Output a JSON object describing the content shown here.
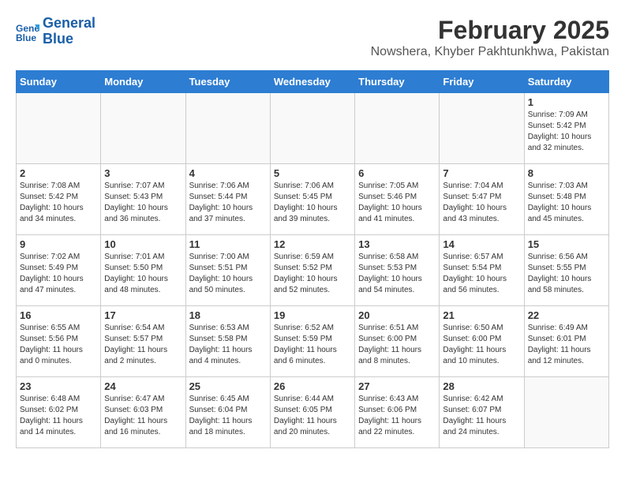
{
  "header": {
    "logo_line1": "General",
    "logo_line2": "Blue",
    "title": "February 2025",
    "subtitle": "Nowshera, Khyber Pakhtunkhwa, Pakistan"
  },
  "weekdays": [
    "Sunday",
    "Monday",
    "Tuesday",
    "Wednesday",
    "Thursday",
    "Friday",
    "Saturday"
  ],
  "weeks": [
    [
      {
        "day": "",
        "sunrise": "",
        "sunset": "",
        "daylight": ""
      },
      {
        "day": "",
        "sunrise": "",
        "sunset": "",
        "daylight": ""
      },
      {
        "day": "",
        "sunrise": "",
        "sunset": "",
        "daylight": ""
      },
      {
        "day": "",
        "sunrise": "",
        "sunset": "",
        "daylight": ""
      },
      {
        "day": "",
        "sunrise": "",
        "sunset": "",
        "daylight": ""
      },
      {
        "day": "",
        "sunrise": "",
        "sunset": "",
        "daylight": ""
      },
      {
        "day": "1",
        "sunrise": "Sunrise: 7:09 AM",
        "sunset": "Sunset: 5:42 PM",
        "daylight": "Daylight: 10 hours and 32 minutes."
      }
    ],
    [
      {
        "day": "2",
        "sunrise": "Sunrise: 7:08 AM",
        "sunset": "Sunset: 5:42 PM",
        "daylight": "Daylight: 10 hours and 34 minutes."
      },
      {
        "day": "3",
        "sunrise": "Sunrise: 7:07 AM",
        "sunset": "Sunset: 5:43 PM",
        "daylight": "Daylight: 10 hours and 36 minutes."
      },
      {
        "day": "4",
        "sunrise": "Sunrise: 7:06 AM",
        "sunset": "Sunset: 5:44 PM",
        "daylight": "Daylight: 10 hours and 37 minutes."
      },
      {
        "day": "5",
        "sunrise": "Sunrise: 7:06 AM",
        "sunset": "Sunset: 5:45 PM",
        "daylight": "Daylight: 10 hours and 39 minutes."
      },
      {
        "day": "6",
        "sunrise": "Sunrise: 7:05 AM",
        "sunset": "Sunset: 5:46 PM",
        "daylight": "Daylight: 10 hours and 41 minutes."
      },
      {
        "day": "7",
        "sunrise": "Sunrise: 7:04 AM",
        "sunset": "Sunset: 5:47 PM",
        "daylight": "Daylight: 10 hours and 43 minutes."
      },
      {
        "day": "8",
        "sunrise": "Sunrise: 7:03 AM",
        "sunset": "Sunset: 5:48 PM",
        "daylight": "Daylight: 10 hours and 45 minutes."
      }
    ],
    [
      {
        "day": "9",
        "sunrise": "Sunrise: 7:02 AM",
        "sunset": "Sunset: 5:49 PM",
        "daylight": "Daylight: 10 hours and 47 minutes."
      },
      {
        "day": "10",
        "sunrise": "Sunrise: 7:01 AM",
        "sunset": "Sunset: 5:50 PM",
        "daylight": "Daylight: 10 hours and 48 minutes."
      },
      {
        "day": "11",
        "sunrise": "Sunrise: 7:00 AM",
        "sunset": "Sunset: 5:51 PM",
        "daylight": "Daylight: 10 hours and 50 minutes."
      },
      {
        "day": "12",
        "sunrise": "Sunrise: 6:59 AM",
        "sunset": "Sunset: 5:52 PM",
        "daylight": "Daylight: 10 hours and 52 minutes."
      },
      {
        "day": "13",
        "sunrise": "Sunrise: 6:58 AM",
        "sunset": "Sunset: 5:53 PM",
        "daylight": "Daylight: 10 hours and 54 minutes."
      },
      {
        "day": "14",
        "sunrise": "Sunrise: 6:57 AM",
        "sunset": "Sunset: 5:54 PM",
        "daylight": "Daylight: 10 hours and 56 minutes."
      },
      {
        "day": "15",
        "sunrise": "Sunrise: 6:56 AM",
        "sunset": "Sunset: 5:55 PM",
        "daylight": "Daylight: 10 hours and 58 minutes."
      }
    ],
    [
      {
        "day": "16",
        "sunrise": "Sunrise: 6:55 AM",
        "sunset": "Sunset: 5:56 PM",
        "daylight": "Daylight: 11 hours and 0 minutes."
      },
      {
        "day": "17",
        "sunrise": "Sunrise: 6:54 AM",
        "sunset": "Sunset: 5:57 PM",
        "daylight": "Daylight: 11 hours and 2 minutes."
      },
      {
        "day": "18",
        "sunrise": "Sunrise: 6:53 AM",
        "sunset": "Sunset: 5:58 PM",
        "daylight": "Daylight: 11 hours and 4 minutes."
      },
      {
        "day": "19",
        "sunrise": "Sunrise: 6:52 AM",
        "sunset": "Sunset: 5:59 PM",
        "daylight": "Daylight: 11 hours and 6 minutes."
      },
      {
        "day": "20",
        "sunrise": "Sunrise: 6:51 AM",
        "sunset": "Sunset: 6:00 PM",
        "daylight": "Daylight: 11 hours and 8 minutes."
      },
      {
        "day": "21",
        "sunrise": "Sunrise: 6:50 AM",
        "sunset": "Sunset: 6:00 PM",
        "daylight": "Daylight: 11 hours and 10 minutes."
      },
      {
        "day": "22",
        "sunrise": "Sunrise: 6:49 AM",
        "sunset": "Sunset: 6:01 PM",
        "daylight": "Daylight: 11 hours and 12 minutes."
      }
    ],
    [
      {
        "day": "23",
        "sunrise": "Sunrise: 6:48 AM",
        "sunset": "Sunset: 6:02 PM",
        "daylight": "Daylight: 11 hours and 14 minutes."
      },
      {
        "day": "24",
        "sunrise": "Sunrise: 6:47 AM",
        "sunset": "Sunset: 6:03 PM",
        "daylight": "Daylight: 11 hours and 16 minutes."
      },
      {
        "day": "25",
        "sunrise": "Sunrise: 6:45 AM",
        "sunset": "Sunset: 6:04 PM",
        "daylight": "Daylight: 11 hours and 18 minutes."
      },
      {
        "day": "26",
        "sunrise": "Sunrise: 6:44 AM",
        "sunset": "Sunset: 6:05 PM",
        "daylight": "Daylight: 11 hours and 20 minutes."
      },
      {
        "day": "27",
        "sunrise": "Sunrise: 6:43 AM",
        "sunset": "Sunset: 6:06 PM",
        "daylight": "Daylight: 11 hours and 22 minutes."
      },
      {
        "day": "28",
        "sunrise": "Sunrise: 6:42 AM",
        "sunset": "Sunset: 6:07 PM",
        "daylight": "Daylight: 11 hours and 24 minutes."
      },
      {
        "day": "",
        "sunrise": "",
        "sunset": "",
        "daylight": ""
      }
    ]
  ]
}
